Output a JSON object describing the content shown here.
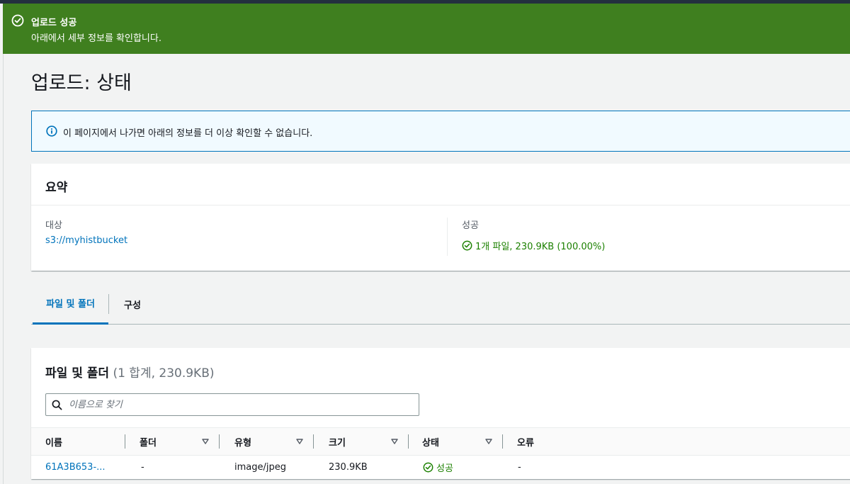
{
  "flash": {
    "title": "업로드 성공",
    "message": "아래에서 세부 정보를 확인합니다."
  },
  "page": {
    "title": "업로드: 상태"
  },
  "info_alert": {
    "text": "이 페이지에서 나가면 아래의 정보를 더 이상 확인할 수 없습니다."
  },
  "summary": {
    "heading": "요약",
    "destination_label": "대상",
    "destination_value": "s3://myhistbucket",
    "success_label": "성공",
    "success_value": "1개 파일, 230.9KB (100.00%)"
  },
  "tabs": [
    {
      "label": "파일 및 폴더",
      "active": true
    },
    {
      "label": "구성",
      "active": false
    }
  ],
  "files": {
    "heading": "파일 및 폴더",
    "count": "(1 합계, 230.9KB)",
    "search_placeholder": "이름으로 찾기",
    "columns": [
      "이름",
      "폴더",
      "유형",
      "크기",
      "상태",
      "오류"
    ],
    "rows": [
      {
        "name": "61A3B653-...",
        "folder": "-",
        "type": "image/jpeg",
        "size": "230.9KB",
        "status": "성공",
        "error": "-"
      }
    ]
  },
  "colors": {
    "success_green": "#3f7f1f",
    "link_blue": "#0073bb",
    "ok_text": "#1d8102"
  }
}
